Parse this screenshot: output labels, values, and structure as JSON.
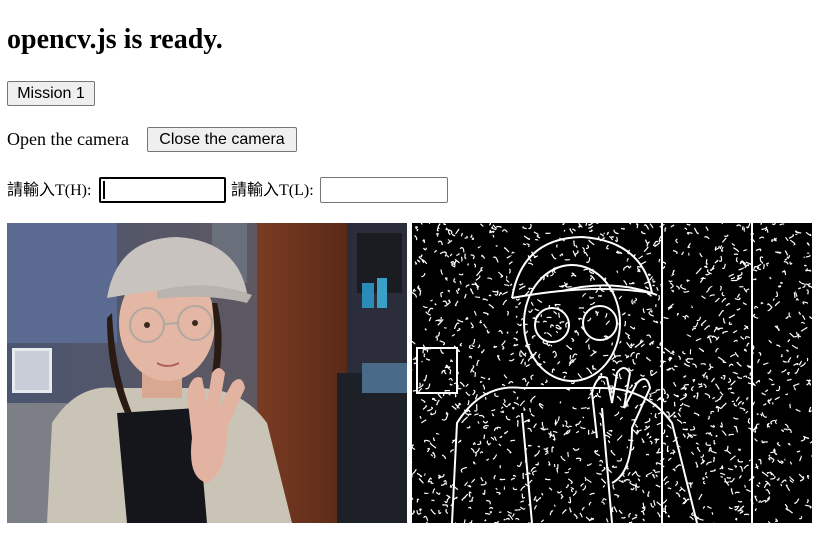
{
  "header": {
    "title": "opencv.js is ready."
  },
  "controls": {
    "mission_label": "Mission 1",
    "open_camera_text": "Open the camera",
    "close_camera_label": "Close the camera"
  },
  "inputs": {
    "high_label_prefix": "請輸入",
    "high_label_suffix": "T(H):",
    "high_value": "",
    "low_label_prefix": "請輸入",
    "low_label_suffix": "T(L):",
    "low_value": ""
  },
  "views": {
    "camera_feed": "camera frame",
    "edge_output": "canny edge output"
  }
}
